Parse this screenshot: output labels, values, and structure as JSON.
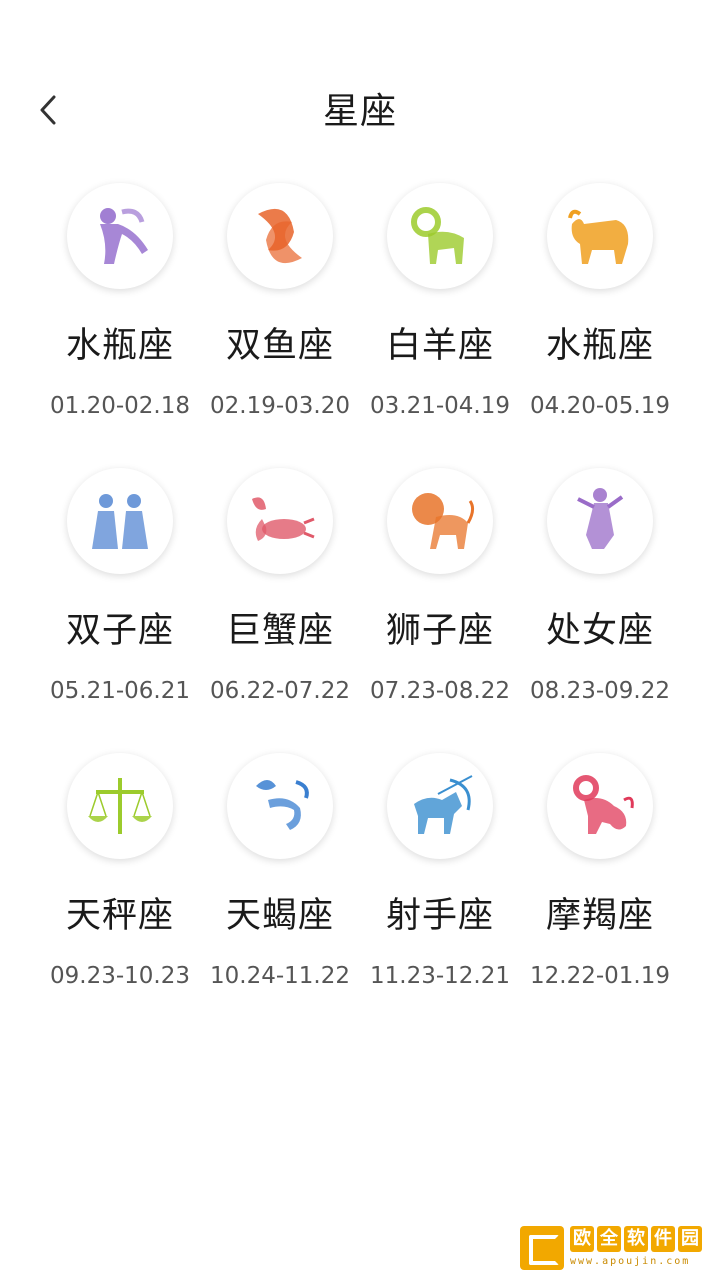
{
  "header": {
    "title": "星座"
  },
  "colors": {
    "accent": "#f2a800",
    "text": "#1a1a1a",
    "subtext": "#555555"
  },
  "signs": [
    {
      "name": "水瓶座",
      "range": "01.20-02.18",
      "icon": "aquarius-icon",
      "color": "#8a5fc8"
    },
    {
      "name": "双鱼座",
      "range": "02.19-03.20",
      "icon": "pisces-icon",
      "color": "#e8642a"
    },
    {
      "name": "白羊座",
      "range": "03.21-04.19",
      "icon": "aries-icon",
      "color": "#9ccb2c"
    },
    {
      "name": "水瓶座",
      "range": "04.20-05.19",
      "icon": "taurus-icon",
      "color": "#f0a020"
    },
    {
      "name": "双子座",
      "range": "05.21-06.21",
      "icon": "gemini-icon",
      "color": "#4a7fd0"
    },
    {
      "name": "巨蟹座",
      "range": "06.22-07.22",
      "icon": "cancer-icon",
      "color": "#e05a6a"
    },
    {
      "name": "狮子座",
      "range": "07.23-08.22",
      "icon": "leo-icon",
      "color": "#e8742a"
    },
    {
      "name": "处女座",
      "range": "08.23-09.22",
      "icon": "virgo-icon",
      "color": "#9a6cc8"
    },
    {
      "name": "天秤座",
      "range": "09.23-10.23",
      "icon": "libra-icon",
      "color": "#9ccb2c"
    },
    {
      "name": "天蝎座",
      "range": "10.24-11.22",
      "icon": "scorpio-icon",
      "color": "#3a7fd0"
    },
    {
      "name": "射手座",
      "range": "11.23-12.21",
      "icon": "sagittarius-icon",
      "color": "#3a8fd0"
    },
    {
      "name": "摩羯座",
      "range": "12.22-01.19",
      "icon": "capricorn-icon",
      "color": "#e03a5a"
    }
  ],
  "watermark": {
    "chars": [
      "欧",
      "全",
      "软",
      "件",
      "园"
    ],
    "url": "www.apoujin.com"
  }
}
